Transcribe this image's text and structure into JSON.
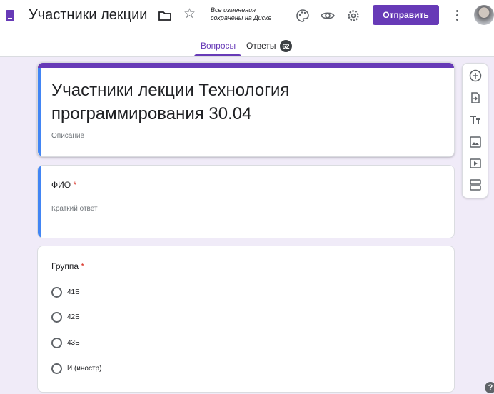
{
  "header": {
    "doc_title": "Участники лекции Тех",
    "saved_note_line1": "Все изменения",
    "saved_note_line2": "сохранены на Диске",
    "send_label": "Отправить"
  },
  "tabs": {
    "questions_label": "Вопросы",
    "answers_label": "Ответы",
    "answers_count": "62"
  },
  "form": {
    "title": "Участники лекции Технология программирования 30.04",
    "description_placeholder": "Описание"
  },
  "questions": [
    {
      "label": "ФИО",
      "required_mark": "*",
      "answer_placeholder": "Краткий ответ"
    },
    {
      "label": "Группа",
      "required_mark": "*",
      "options": [
        "41Б",
        "42Б",
        "43Б",
        "И (иностр)"
      ]
    }
  ],
  "icons": {
    "toolbar": [
      "add-question-icon",
      "import-questions-icon",
      "add-title-icon",
      "add-image-icon",
      "add-video-icon",
      "add-section-icon"
    ],
    "header": [
      "forms-logo-icon",
      "folder-icon",
      "star-icon",
      "palette-icon",
      "eye-icon",
      "gear-icon",
      "more-vert-icon"
    ]
  },
  "colors": {
    "accent": "#673ab7",
    "selected_bar": "#4285f4",
    "background": "#f0ebf8",
    "required": "#d93025"
  }
}
